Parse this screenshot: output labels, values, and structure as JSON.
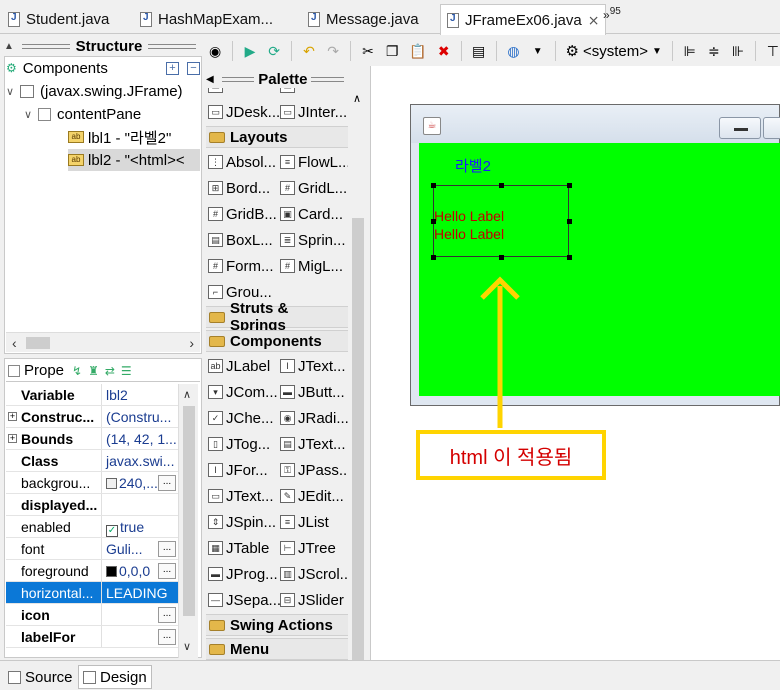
{
  "editor_tabs": [
    {
      "label": "Student.java"
    },
    {
      "label": "HashMapExam..."
    },
    {
      "label": "Message.java"
    },
    {
      "label": "JFrameEx06.java",
      "active": true
    }
  ],
  "overflow_tabs": {
    "label": "»",
    "count": "95"
  },
  "structure": {
    "title": "Structure"
  },
  "components": {
    "title": "Components",
    "tree": [
      {
        "label": "(javax.swing.JFrame)"
      },
      {
        "label": "contentPane"
      },
      {
        "label": "lbl1 - \"라벨2\""
      },
      {
        "label": "lbl2 - \"<html><",
        "selected": true
      }
    ]
  },
  "properties": {
    "title": "Prope",
    "rows": [
      {
        "name": "Variable",
        "value": "lbl2",
        "bold": true
      },
      {
        "name": "Construc...",
        "value": "(Constru...",
        "bold": true,
        "expandable": true
      },
      {
        "name": "Bounds",
        "value": "(14, 42, 1...",
        "bold": true,
        "expandable": true
      },
      {
        "name": "Class",
        "value": "javax.swi...",
        "bold": true
      },
      {
        "name": "backgrou...",
        "value": "240,...",
        "swatch": "#f0f0f0",
        "button": true
      },
      {
        "name": "displayed...",
        "value": "",
        "bold": true
      },
      {
        "name": "enabled",
        "value": "true",
        "checkbox": true
      },
      {
        "name": "font",
        "value": "Guli...",
        "button": true
      },
      {
        "name": "foreground",
        "value": "0,0,0",
        "swatch": "#000000",
        "button": true
      },
      {
        "name": "horizontal...",
        "value": "LEADING",
        "selected": true
      },
      {
        "name": "icon",
        "value": "",
        "bold": true,
        "button": true
      },
      {
        "name": "labelFor",
        "value": "",
        "bold": true,
        "button": true
      }
    ]
  },
  "toolbar": {
    "system_combo": "<system>"
  },
  "palette": {
    "title": "Palette",
    "top_items": [
      "JDesk...",
      "JInter..."
    ],
    "categories": {
      "layouts": "Layouts",
      "struts": "Struts & Springs",
      "components": "Components",
      "swing_actions": "Swing Actions",
      "menu": "Menu"
    },
    "layout_items": [
      "Absol...",
      "FlowL...",
      "Bord...",
      "GridL...",
      "GridB...",
      "Card...",
      "BoxL...",
      "Sprin...",
      "Form...",
      "MigL...",
      "Grou..."
    ],
    "component_items": [
      "JLabel",
      "JText...",
      "JCom...",
      "JButt...",
      "JChe...",
      "JRadi...",
      "JTog...",
      "JText...",
      "JFor...",
      "JPass...",
      "JText...",
      "JEdit...",
      "JSpin...",
      "JList",
      "JTable",
      "JTree",
      "JProg...",
      "JScrol...",
      "JSepa...",
      "JSlider"
    ]
  },
  "canvas": {
    "lbl1_text": "라벨2",
    "lbl2_line1": "Hello Label",
    "lbl2_line2": "Hello Label"
  },
  "annotation": {
    "text": "html 이 적용됨",
    "border_color": "#ffd400",
    "text_color": "#d40000"
  },
  "bottom_tabs": [
    {
      "label": "Source"
    },
    {
      "label": "Design",
      "active": true
    }
  ],
  "colors": {
    "content_pane": "#00ff00",
    "selection": "#0b78d7",
    "lbl1": "#1a1aff",
    "lbl2": "#c40000"
  }
}
